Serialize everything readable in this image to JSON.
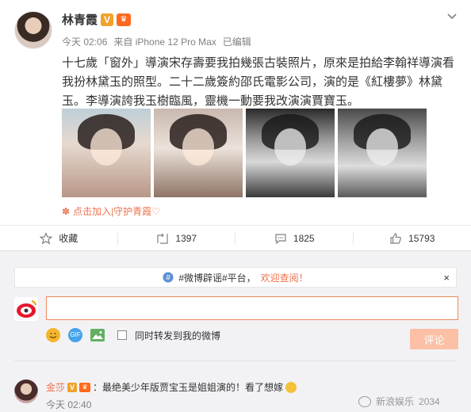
{
  "post": {
    "author": "林青霞",
    "time": "今天 02:06",
    "via": "来自 iPhone 12 Pro Max",
    "edited": "已编辑",
    "text": "十七歲「窗外」導演宋存壽要我拍幾張古裝照片，原來是拍給李翰祥導演看我扮林黛玉的照型。二十二歲簽約邵氏電影公司，演的是《紅樓夢》林黛玉。李導演誇我玉樹臨風，靈機一動要我改演演賈寶玉。",
    "source": "点击加入|守护青霞♡",
    "badge_v": "V"
  },
  "actions": {
    "favorite": "收藏",
    "repost": "1397",
    "comment": "1825",
    "like": "15793"
  },
  "comments": {
    "notice_prefix": "#微博辟谣#平台，",
    "notice_highlight": "欢迎查阅！",
    "notice_close": "×",
    "input_value": "",
    "repost_checkbox_label": "同时转发到我的微博",
    "submit": "评论",
    "gif_label": "GIF",
    "list": [
      {
        "name": "金莎",
        "text": "：最绝美少年版贾宝玉是姐姐演的！看了想嫁",
        "time": "今天 02:40"
      }
    ]
  },
  "watermark": {
    "text": "新浪娱乐",
    "count": "2034"
  },
  "colors": {
    "accent": "#eb7350",
    "vip": "#f0a22a",
    "panel": "#f2f2f5"
  }
}
